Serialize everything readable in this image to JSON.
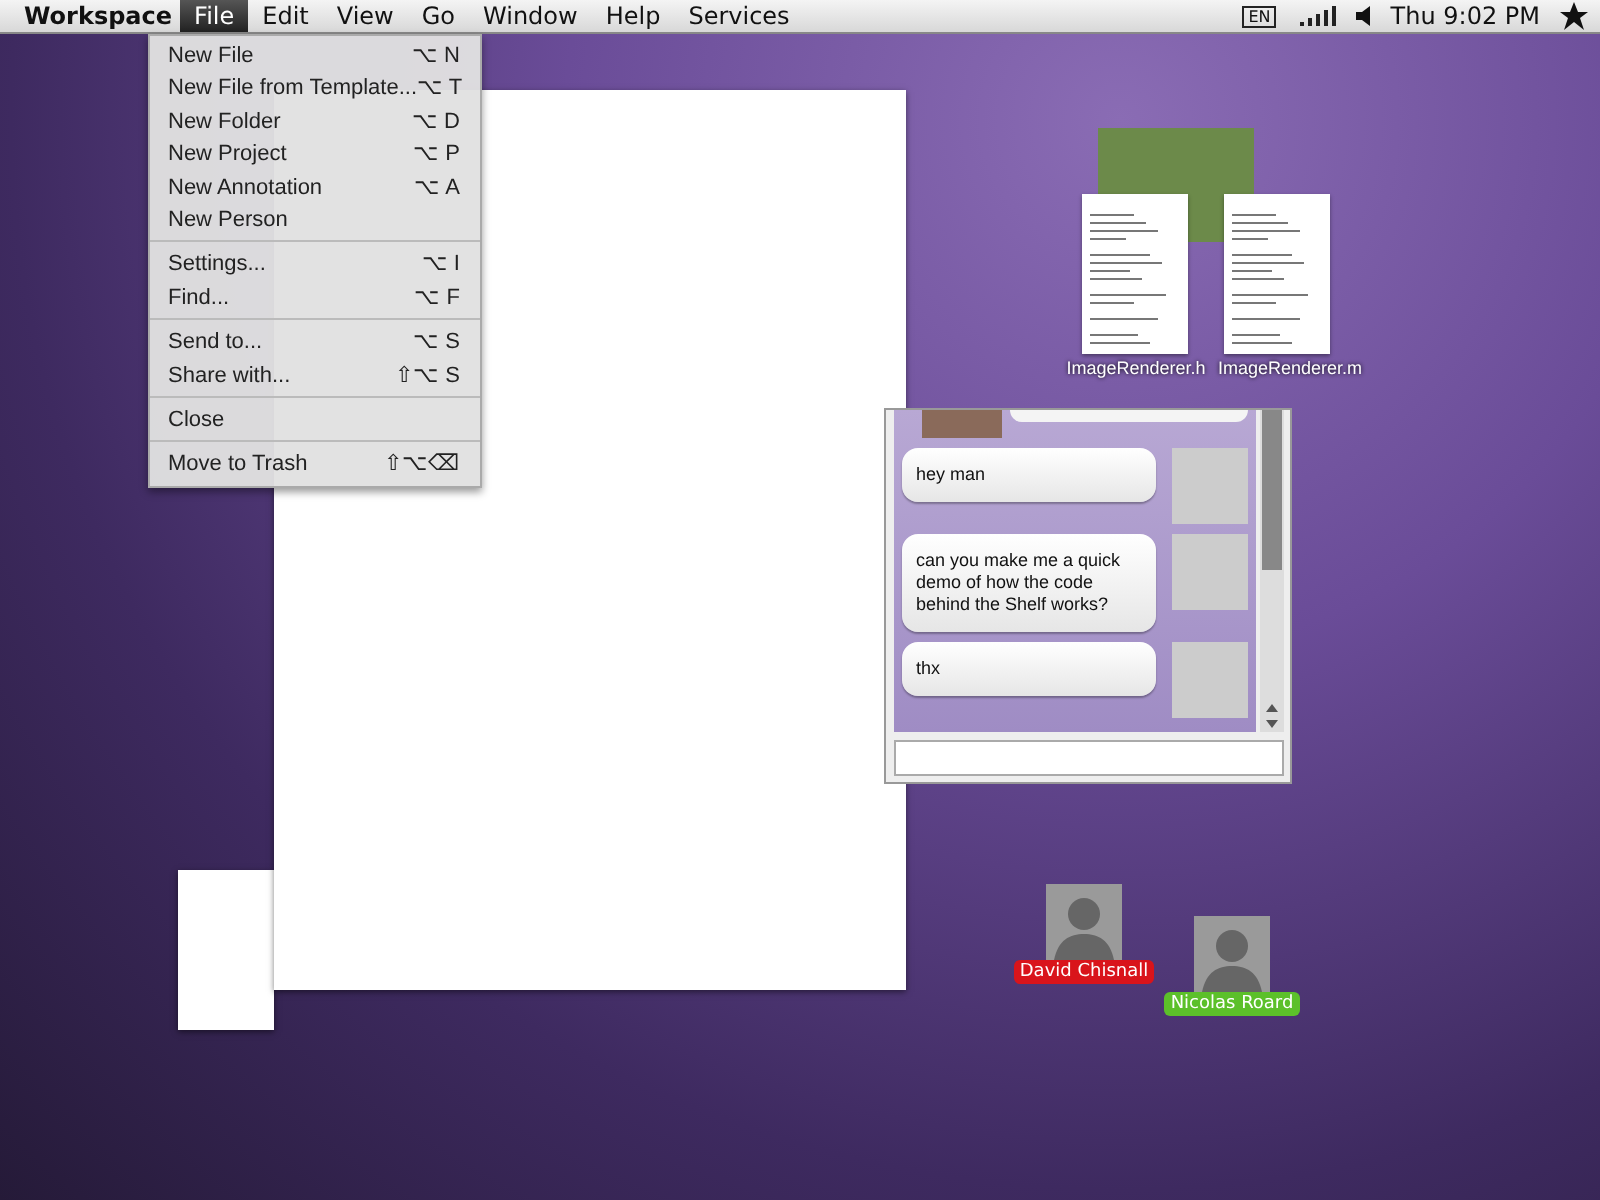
{
  "menu_bar": {
    "app_name": "Workspace",
    "menus": [
      {
        "label": "File",
        "selected": true
      },
      {
        "label": "Edit",
        "selected": false
      },
      {
        "label": "View",
        "selected": false
      },
      {
        "label": "Go",
        "selected": false
      },
      {
        "label": "Window",
        "selected": false
      },
      {
        "label": "Help",
        "selected": false
      },
      {
        "label": "Services",
        "selected": false
      }
    ],
    "keyboard_layout": "EN",
    "clock": "Thu 9:02 PM"
  },
  "file_menu": {
    "groups": [
      [
        {
          "label": "New File",
          "shortcut": "⌥ N"
        },
        {
          "label": "New File from Template...",
          "shortcut": "⌥ T"
        },
        {
          "label": "New Folder",
          "shortcut": "⌥ D"
        },
        {
          "label": "New Project",
          "shortcut": "⌥ P"
        },
        {
          "label": "New Annotation",
          "shortcut": "⌥ A"
        },
        {
          "label": "New Person"
        }
      ],
      [
        {
          "label": "Settings...",
          "shortcut": "⌥ I"
        },
        {
          "label": "Find...",
          "shortcut": "⌥ F"
        }
      ],
      [
        {
          "label": "Send to...",
          "shortcut": "⌥ S"
        },
        {
          "label": "Share with...",
          "shortcut": "⇧⌥ S"
        }
      ],
      [
        {
          "label": "Close"
        }
      ],
      [
        {
          "label": "Move to Trash",
          "shortcut": "⇧⌥⌫"
        }
      ]
    ]
  },
  "desktop": {
    "files": [
      {
        "name": "ImageRenderer.h"
      },
      {
        "name": "ImageRenderer.m"
      }
    ],
    "chat": {
      "messages": [
        {
          "text": "hey man"
        },
        {
          "text": "can you make me a quick demo of how the code behind the Shelf works?"
        },
        {
          "text": "thx"
        }
      ]
    },
    "people": [
      {
        "name": "David Chisnall",
        "color": "#d9141b"
      },
      {
        "name": "Nicolas Roard",
        "color": "#5cc02a"
      }
    ]
  }
}
